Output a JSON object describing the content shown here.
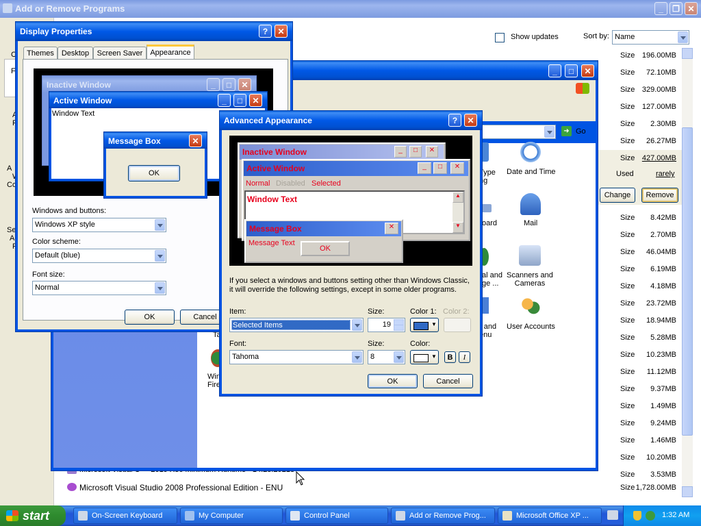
{
  "arp": {
    "title": "Add or Remove Programs",
    "show_updates": "Show updates",
    "sort_by": "Sort by:",
    "sort_value": "Name",
    "size_label": "Size",
    "used_label": "Used",
    "used_value": "rarely",
    "change": "Change",
    "remove": "Remove",
    "rows": [
      "196.00MB",
      "72.10MB",
      "329.00MB",
      "127.00MB",
      "2.30MB",
      "26.27MB",
      "427.00MB"
    ],
    "rows2": [
      "8.42MB",
      "2.70MB",
      "46.04MB",
      "6.19MB",
      "4.18MB",
      "23.72MB",
      "18.94MB",
      "5.28MB",
      "10.23MB",
      "11.12MB",
      "9.37MB",
      "1.49MB",
      "9.24MB",
      "1.46MB",
      "10.20MB",
      "3.53MB",
      "1,728.00MB"
    ],
    "prog_partial": "Microsoft Visual C++ 2019 X86 Minimum Runtime - 14.28.29213",
    "prog_last": "Microsoft Visual Studio 2008 Professional Edition - ENU",
    "left_frag": [
      "C",
      "F",
      "A",
      "F",
      "A",
      "W",
      "Co",
      "Se",
      "Ac",
      "P"
    ]
  },
  "cp": {
    "go": "Go",
    "items": [
      {
        "label": "Type\nng"
      },
      {
        "label": "Date and Time"
      },
      {
        "label": "oard"
      },
      {
        "label": "Mail"
      },
      {
        "label": "al and\nge ..."
      },
      {
        "label": "Scanners and\nCameras"
      },
      {
        "label": "r and\nenu"
      },
      {
        "label": "User Accounts"
      },
      {
        "label": "Ta"
      },
      {
        "label": "Win\nFire"
      }
    ]
  },
  "dp": {
    "title": "Display Properties",
    "tabs": [
      "Themes",
      "Desktop",
      "Screen Saver",
      "Appearance"
    ],
    "preview": {
      "inactive": "Inactive Window",
      "active": "Active Window",
      "window_text": "Window Text",
      "message_box": "Message Box",
      "ok": "OK"
    },
    "windows_buttons_label": "Windows and buttons:",
    "windows_buttons_value": "Windows XP style",
    "color_scheme_label": "Color scheme:",
    "color_scheme_value": "Default (blue)",
    "font_size_label": "Font size:",
    "font_size_value": "Normal",
    "ok": "OK",
    "cancel": "Cancel"
  },
  "aa": {
    "title": "Advanced Appearance",
    "preview": {
      "inactive": "Inactive Window",
      "active": "Active Window",
      "normal": "Normal",
      "disabled": "Disabled",
      "selected": "Selected",
      "window_text": "Window Text",
      "message_box": "Message Box",
      "message_text": "Message Text",
      "ok": "OK"
    },
    "note": "If you select a windows and buttons setting other than Windows Classic, it will override the following settings, except in some older programs.",
    "item_label": "Item:",
    "item_value": "Selected Items",
    "size_label": "Size:",
    "size_value": "19",
    "color1_label": "Color 1:",
    "color2_label": "Color 2:",
    "font_label": "Font:",
    "font_value": "Tahoma",
    "font_size_label": "Size:",
    "font_size_value": "8",
    "color_label": "Color:",
    "bold": "B",
    "italic": "I",
    "ok": "OK",
    "cancel": "Cancel"
  },
  "taskbar": {
    "start": "start",
    "items": [
      "On-Screen Keyboard",
      "My Computer",
      "Control Panel",
      "Add or Remove Prog...",
      "Microsoft Office XP ..."
    ],
    "clock": "1:32 AM"
  },
  "colors": {
    "xp_blue": "#0054e3",
    "face": "#ece9d8",
    "selection": "#316ac5",
    "preview_red": "#e8001c"
  }
}
